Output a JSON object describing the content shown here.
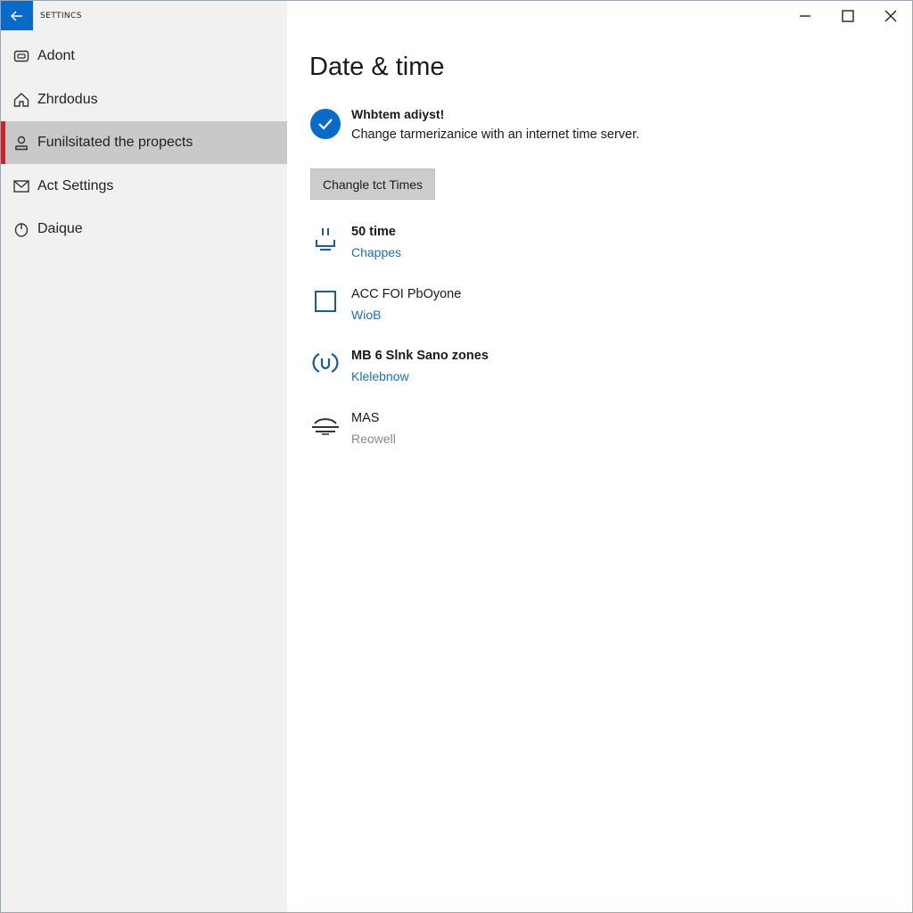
{
  "window": {
    "app_title": "SETTINCS",
    "controls": {
      "minimize_icon": "minimize-icon",
      "maximize_icon": "maximize-icon",
      "close_icon": "close-icon"
    }
  },
  "sidebar": {
    "items": [
      {
        "label": "Adont",
        "icon": "account-icon",
        "active": false
      },
      {
        "label": "Zhrdodus",
        "icon": "home-icon",
        "active": false
      },
      {
        "label": "Funilsitated the propects",
        "icon": "person-icon",
        "active": true
      },
      {
        "label": "Act Settings",
        "icon": "mail-icon",
        "active": false
      },
      {
        "label": "Daique",
        "icon": "power-icon",
        "active": false
      }
    ]
  },
  "main": {
    "title": "Date & time",
    "status": {
      "title": "Whbtem adiyst!",
      "description": "Change tarmerizanice with an internet time server."
    },
    "button_label": "Changle tct Times",
    "settings": [
      {
        "title": "50 time",
        "subtitle": "Chappes",
        "icon": "plug-icon"
      },
      {
        "title": "ACC FOI PbOyone",
        "subtitle": "WioB",
        "icon": "square-icon"
      },
      {
        "title": "MB 6 Slnk Sano zones",
        "subtitle": "Klelebnow",
        "icon": "sync-icon"
      },
      {
        "title": "MAS",
        "subtitle": "Reowell",
        "icon": "wifi-icon"
      }
    ]
  },
  "colors": {
    "accent": "#0a6ac8",
    "active_indicator": "#c8262c",
    "link": "#1c6fb3"
  }
}
